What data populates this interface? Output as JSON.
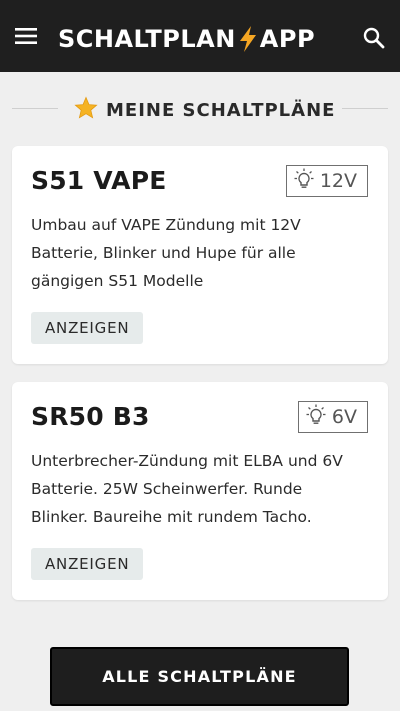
{
  "appbar": {
    "brand_left": "SCHALTPLAN",
    "brand_right": "APP",
    "menu_icon": "hamburger-menu-icon",
    "search_icon": "search-icon",
    "bolt_icon": "lightning-bolt-icon",
    "bolt_color": "#f5a623",
    "background": "#1f1f1f"
  },
  "section": {
    "title": "MEINE SCHALTPLÄNE",
    "icon": "star-icon",
    "icon_color": "#f5b323"
  },
  "cards": [
    {
      "name": "S51 VAPE",
      "voltage": "12V",
      "voltage_icon": "lightbulb-icon",
      "description": "Umbau auf VAPE Zündung mit 12V Batterie, Blinker und Hupe für alle gängigen S51 Modelle",
      "button_label": "ANZEIGEN"
    },
    {
      "name": "SR50 B3",
      "voltage": "6V",
      "voltage_icon": "lightbulb-icon",
      "description": "Unterbrecher-Zündung mit ELBA und 6V Batterie. 25W Scheinwerfer. Runde Blinker. Baureihe mit rundem Tacho.",
      "button_label": "ANZEIGEN"
    }
  ],
  "footer": {
    "all_button_label": "ALLE SCHALTPLÄNE"
  }
}
